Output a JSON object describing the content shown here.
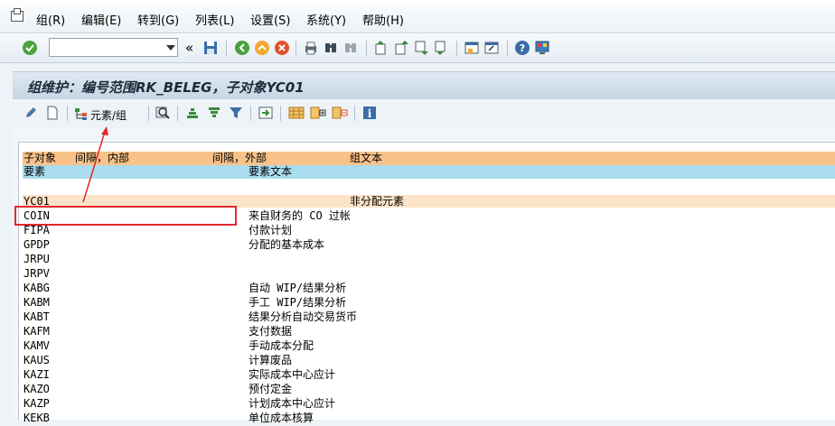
{
  "menubar": {
    "items": [
      "组(R)",
      "编辑(E)",
      "转到(G)",
      "列表(L)",
      "设置(S)",
      "系统(Y)",
      "帮助(H)"
    ]
  },
  "toolbar": {
    "command_value": ""
  },
  "title": "组维护：编号范围RK_BELEG，子对象YC01",
  "app_toolbar": {
    "elements_group_label": "元素/组"
  },
  "list": {
    "header1": {
      "col_subobject": "子对象",
      "col_interval_internal": "间隔，内部",
      "col_interval_external": "间隔，外部",
      "col_group_text": "组文本"
    },
    "header2": {
      "col_element": "要素",
      "col_element_text": "要素文本"
    },
    "subobject_row": {
      "code": "YC01",
      "text": "非分配元素"
    },
    "rows": [
      {
        "code": "COIN",
        "text": "来自财务的 CO 过帐"
      },
      {
        "code": "FIPA",
        "text": "付款计划"
      },
      {
        "code": "GPDP",
        "text": "分配的基本成本"
      },
      {
        "code": "JRPU",
        "text": ""
      },
      {
        "code": "JRPV",
        "text": ""
      },
      {
        "code": "KABG",
        "text": "自动 WIP/结果分析"
      },
      {
        "code": "KABM",
        "text": "手工 WIP/结果分析"
      },
      {
        "code": "KABT",
        "text": "结果分析自动交易货币"
      },
      {
        "code": "KAFM",
        "text": "支付数据"
      },
      {
        "code": "KAMV",
        "text": "手动成本分配"
      },
      {
        "code": "KAUS",
        "text": "计算废品"
      },
      {
        "code": "KAZI",
        "text": "实际成本中心应计"
      },
      {
        "code": "KAZO",
        "text": "预付定金"
      },
      {
        "code": "KAZP",
        "text": "计划成本中心应计"
      },
      {
        "code": "KEKB",
        "text": "单位成本核算"
      }
    ]
  },
  "colors": {
    "header1_bg": "#f9c28a",
    "header2_bg": "#a9ddef",
    "subobject_bg": "#fde4c8",
    "highlight_box": "#e0292e"
  }
}
